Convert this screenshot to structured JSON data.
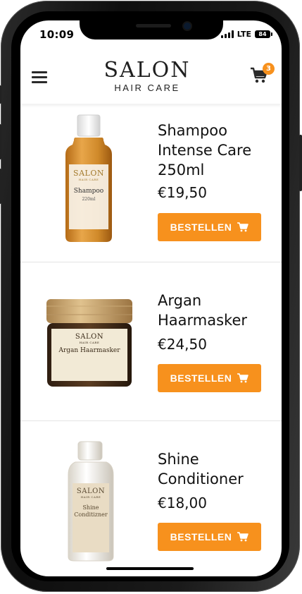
{
  "status_bar": {
    "time": "10:09",
    "network": "LTE",
    "battery": "84"
  },
  "header": {
    "logo_main": "SALON",
    "logo_sub": "HAIR CARE",
    "cart_count": "3"
  },
  "colors": {
    "accent": "#f7911d",
    "text": "#111111",
    "divider": "#e4e4e4"
  },
  "icons": {
    "menu": "hamburger-menu-icon",
    "cart": "shopping-cart-icon"
  },
  "products": [
    {
      "name": "Shampoo Intense Care 250ml",
      "price": "€19,50",
      "button": "BESTELLEN",
      "image": {
        "brand": "SALON",
        "brand_sub": "HAIR CARE",
        "label": "Shampoo",
        "size": "220ml"
      }
    },
    {
      "name": "Argan Haarmasker",
      "price": "€24,50",
      "button": "BESTELLEN",
      "image": {
        "brand": "SALON",
        "brand_sub": "HAIR CARE",
        "label": "Argan Haarmasker"
      }
    },
    {
      "name": "Shine Conditioner",
      "price": "€18,00",
      "button": "BESTELLEN",
      "image": {
        "brand": "SALON",
        "brand_sub": "HAIR CARE",
        "label": "Shine Conditizner"
      }
    }
  ]
}
